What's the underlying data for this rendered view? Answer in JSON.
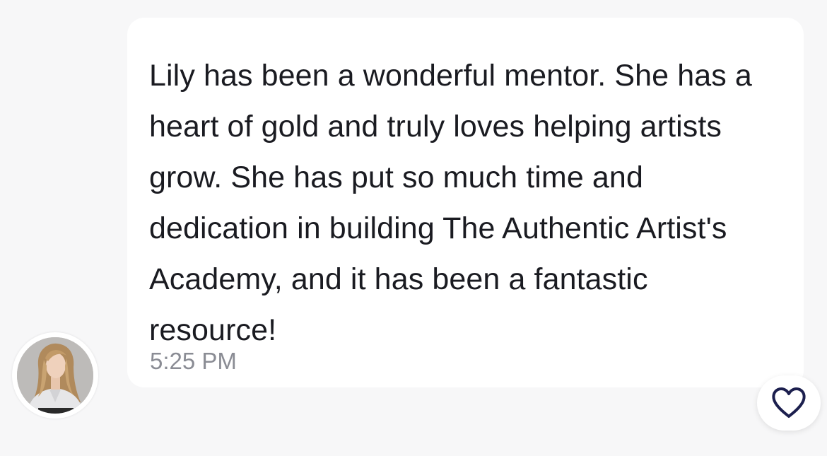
{
  "message": {
    "text": "Lily has been a wonderful mentor. She has a heart of gold and truly loves helping artists grow. She has put so much time and dedication in building The Authentic Artist's Academy, and it has been a fantastic resource!",
    "time": "5:25 PM"
  },
  "sender": {
    "avatar_icon": "user-photo-avatar"
  },
  "reaction": {
    "icon": "heart-outline-icon",
    "color": "#1c1f4e"
  },
  "colors": {
    "background": "#f7f7f8",
    "bubble": "#ffffff",
    "text": "#1a1b21",
    "timestamp": "#8a8c94"
  }
}
